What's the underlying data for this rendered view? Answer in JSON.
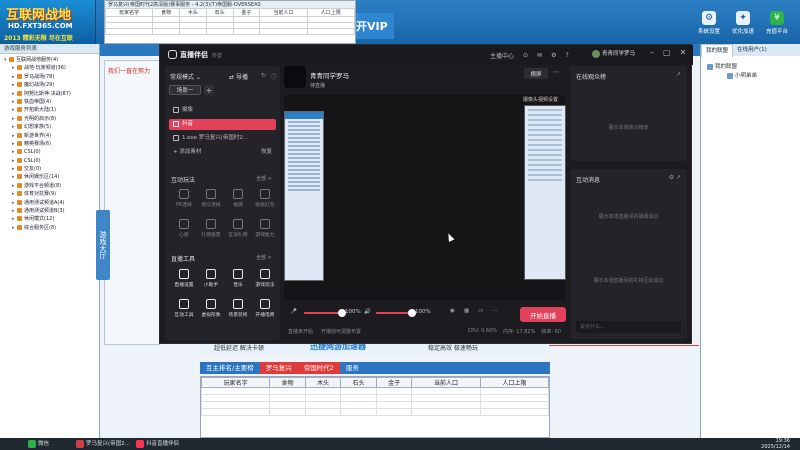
{
  "app": {
    "logo_line1": "互联网战地",
    "logo_line2": "HD.FXT365.COM",
    "logo_line3": "2013 精彩无限 尽在互联",
    "banner_vip": "开VIP",
    "top_buttons": [
      {
        "label": "系统设置",
        "icon": "gear-icon"
      },
      {
        "label": "优化加速",
        "icon": "boost-icon"
      },
      {
        "label": "充值平台",
        "icon": "wallet-icon"
      }
    ],
    "tree_header": "游戏服务列表",
    "tree_items": [
      "互联网战地服务(4)",
      "战地·玩家频道(36)",
      "罗马战场(78)",
      "魔幻战场(29)",
      "阿努比斯神·决战(87)",
      "铁血帝国(4)",
      "开拓新大陆(1)",
      "光明的启示(8)",
      "幻想家族(5)",
      "新游世界(4)",
      "精英赛场(6)",
      "CSL(0)",
      "CSL(0)",
      "交友(0)",
      "休闲娱乐区(14)",
      "游戏平台频道(8)",
      "体育对抗赛(9)",
      "通用测试频道A(4)",
      "通用测试频道B(3)",
      "休闲模式(12)",
      "综合服务区(8)"
    ],
    "mini_window_title": "罗马复兴(帝国时代2高清版)赛事服务 - 4.2(3)(T)帝国服-OVERSEAS",
    "mini_headers": [
      "玩家名字",
      "食物",
      "木头",
      "石头",
      "金子",
      "当前人口",
      "人口上限"
    ],
    "mid_tag": "我们一直在努力",
    "side_tab": "游戏大厅",
    "bottom_left": "超低延迟 解决卡顿",
    "bottom_brand": "迅捷网游加速器",
    "bottom_right": "稳定高效 极速畅玩",
    "rank_cells": [
      "互主排名/主要榜",
      "罗马复兴",
      "帝国时代2",
      "服务"
    ],
    "grid_headers": [
      "玩家名字",
      "食物",
      "木头",
      "石头",
      "金子",
      "当前人口",
      "人口上限"
    ],
    "right_tabs": [
      "我的联盟",
      "在线用户(1)"
    ],
    "right_node1": "我的联盟",
    "right_node2": "小明弟弟"
  },
  "live": {
    "title": "直播伴侣",
    "subtitle": "抖音",
    "toolbar_icons": [
      "主播中心",
      "tool-icon",
      "message-icon",
      "settings-icon",
      "help-icon"
    ],
    "toolbar_label": "主播中心",
    "user_name": "青青同学罗马",
    "window_buttons": [
      "minimize-icon",
      "maximize-icon",
      "close-icon"
    ],
    "mode_label": "常规模式",
    "mode_toggle": "导播",
    "scene_tab": "场景一",
    "sources": [
      {
        "label": "摄像",
        "active": false
      },
      {
        "label": "抖音",
        "active": true
      },
      {
        "label": "1.exe 罗马复兴(帝国时2...",
        "active": false
      }
    ],
    "add_source": "添加素材",
    "add_source_right": "恢复",
    "interact_title": "互动玩法",
    "interact_more": "全部 >",
    "interact_items": [
      "PK连线",
      "观众连线",
      "福袋",
      "贴纸红包",
      "心愿",
      "礼物投票",
      "互动礼物",
      "游戏能力"
    ],
    "tools_title": "直播工具",
    "tools_more": "全部 >",
    "tool_items": [
      "直播设置",
      "小助手",
      "音乐",
      "游戏玩法",
      "互动工具",
      "虚拟形象",
      "场景装修",
      "开播电商"
    ],
    "streamer_name": "青青同学罗马",
    "streamer_sub": "待直播",
    "preview_tab": "横屏",
    "preview_label": "摄像头视频设置",
    "volume_mic": "100%",
    "volume_speaker": "100%",
    "start_button": "开始直播",
    "status_left": "直播未开始",
    "status_mid": "开播前可调整布置",
    "status_cpu": "CPU: 0.60%",
    "status_mem": "内存: 17.82%",
    "status_fps": "帧率: 60",
    "viewers_title": "在线观众榜",
    "viewers_empty": "展示本场观众榜单",
    "messages_title": "互动消息",
    "messages_empty1": "展示本场直播间的弹幕消息",
    "messages_empty2": "展示本场直播间的礼物互动消息",
    "input_placeholder": "说点什么..."
  },
  "taskbar": {
    "items": [
      {
        "label": "微信",
        "color": "#2db14a"
      },
      {
        "label": "罗马复兴(帝国2...",
        "color": "#d04040"
      },
      {
        "label": "抖音直播伴侣",
        "color": "#ff3355"
      }
    ],
    "time": "19:36",
    "date": "2025/12/14"
  }
}
